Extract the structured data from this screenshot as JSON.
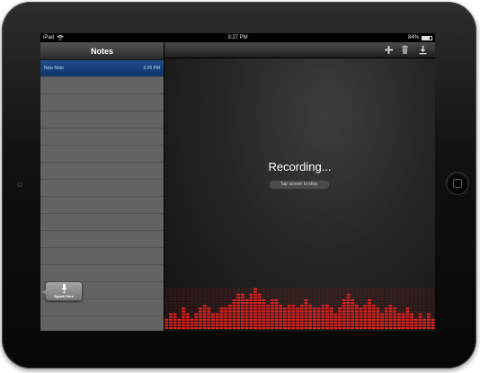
{
  "status_bar": {
    "device": "iPad",
    "time": "3:27 PM",
    "battery": "84%",
    "battery_level": 0.84
  },
  "sidebar": {
    "title": "Notes",
    "notes": [
      {
        "title": "New Note",
        "time": "3:26 PM",
        "selected": true
      }
    ]
  },
  "toolbar": {
    "buttons": [
      "plus-icon",
      "trash-icon",
      "download-icon"
    ]
  },
  "recording": {
    "title": "Recording...",
    "hint": "Tap screen to stop."
  },
  "speak_button": {
    "label": "Speak Here",
    "icon": "microphone-icon"
  },
  "colors": {
    "accent_red": "#e0201d",
    "selection_blue": "#1e4e8a"
  },
  "equalizer_levels": [
    2,
    3,
    3,
    2,
    4,
    3,
    2,
    3,
    4,
    5,
    4,
    3,
    3,
    4,
    4,
    5,
    6,
    7,
    7,
    6,
    7,
    8,
    7,
    6,
    5,
    6,
    6,
    5,
    4,
    5,
    5,
    4,
    5,
    6,
    5,
    4,
    4,
    5,
    5,
    4,
    3,
    4,
    6,
    7,
    6,
    5,
    4,
    5,
    6,
    5,
    4,
    3,
    4,
    5,
    4,
    3,
    3,
    4,
    3,
    2,
    3,
    2,
    3,
    2
  ],
  "equalizer_max": 8
}
